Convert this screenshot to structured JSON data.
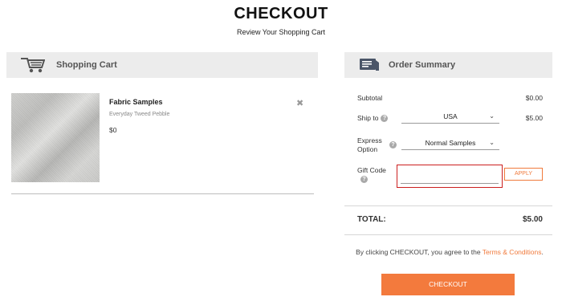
{
  "header": {
    "title": "CHECKOUT",
    "subtitle": "Review Your Shopping Cart"
  },
  "cart": {
    "title": "Shopping Cart",
    "icon": "shopping-cart-icon",
    "item": {
      "name": "Fabric Samples",
      "variant": "Everyday Tweed Pebble",
      "price": "$0",
      "remove_icon": "close-icon",
      "remove_glyph": "✖"
    }
  },
  "summary": {
    "title": "Order Summary",
    "icon": "receipt-icon",
    "subtotal_label": "Subtotal",
    "subtotal_value": "$0.00",
    "ship_label": "Ship to",
    "ship_country": "USA",
    "ship_value": "$5.00",
    "express_label": "Express Option",
    "express_value": "Normal Samples",
    "gift_label": "Gift Code",
    "gift_value": "",
    "apply_label": "APPLY",
    "help_glyph": "?",
    "chevron_glyph": "⌄",
    "total_label": "TOTAL:",
    "total_value": "$5.00",
    "agree_text": "By clicking CHECKOUT, you agree to the ",
    "terms_text": "Terms & Conditions",
    "agree_end": ".",
    "checkout_label": "CHECKOUT"
  },
  "colors": {
    "accent": "#f37a3d",
    "panel_bg": "#ececec",
    "highlight": "#cc1f1f"
  }
}
